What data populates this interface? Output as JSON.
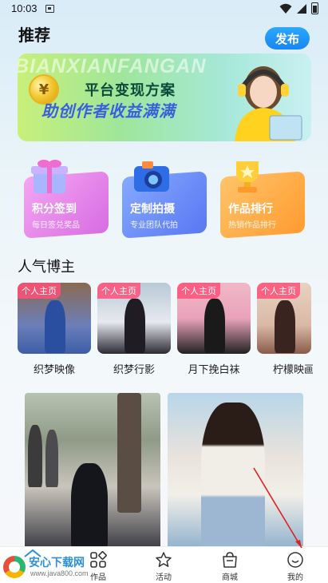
{
  "status_bar": {
    "time": "10:03"
  },
  "header": {
    "title": "推荐",
    "publish_label": "发布"
  },
  "banner": {
    "bg_text": "BIANXIANFANGAN",
    "coin_symbol": "¥",
    "line1": "平台变现方案",
    "line2": "助创作者收益满满"
  },
  "features": [
    {
      "title": "积分签到",
      "subtitle": "每日签兑奖品",
      "icon": "gift-icon"
    },
    {
      "title": "定制拍摄",
      "subtitle": "专业团队代拍",
      "icon": "camera-icon"
    },
    {
      "title": "作品排行",
      "subtitle": "热销作品排行",
      "icon": "trophy-icon"
    }
  ],
  "creators": {
    "section_title": "人气博主",
    "badge": "个人主页",
    "items": [
      {
        "name": "织梦映像"
      },
      {
        "name": "织梦行影"
      },
      {
        "name": "月下挽白袜"
      },
      {
        "name": "柠檬映画"
      }
    ]
  },
  "bottom_nav": [
    {
      "label": "作品",
      "icon": "grid-icon"
    },
    {
      "label": "活动",
      "icon": "star-icon"
    },
    {
      "label": "商城",
      "icon": "shop-bag-icon"
    },
    {
      "label": "我的",
      "icon": "profile-icon"
    }
  ],
  "watermark": {
    "title": "安心下载网",
    "url": "www.java800.com"
  },
  "colors": {
    "accent": "#1a86f0",
    "badge": "#ff5078"
  }
}
